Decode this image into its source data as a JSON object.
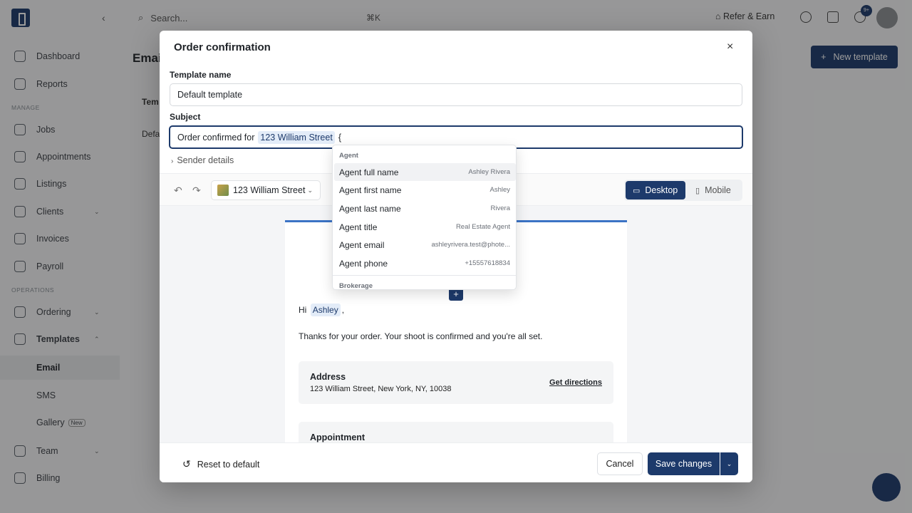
{
  "sidebar": {
    "items": [
      {
        "label": "Dashboard"
      },
      {
        "label": "Reports"
      },
      {
        "label": "Jobs"
      },
      {
        "label": "Appointments"
      },
      {
        "label": "Listings"
      },
      {
        "label": "Clients"
      },
      {
        "label": "Invoices"
      },
      {
        "label": "Payroll"
      },
      {
        "label": "Ordering"
      },
      {
        "label": "Templates"
      },
      {
        "label": "Team"
      },
      {
        "label": "Billing"
      }
    ],
    "sections": [
      "MANAGE",
      "OPERATIONS"
    ],
    "sub_items": [
      {
        "label": "Email"
      },
      {
        "label": "SMS"
      },
      {
        "label": "Gallery"
      }
    ],
    "new_tag": "New"
  },
  "topbar": {
    "search_placeholder": "Search...",
    "search_shortcut": "⌘K",
    "refer_label": "Refer & Earn",
    "notification_count": "9+"
  },
  "page": {
    "title": "Emai",
    "new_template_label": "New template",
    "col_header": "Tem",
    "row_text": "Defa"
  },
  "modal": {
    "title": "Order confirmation",
    "close_glyph": "×",
    "template_name_label": "Template name",
    "template_name_value": "Default template",
    "subject_label": "Subject",
    "subject_prefix": "Order confirmed for",
    "subject_chip": "123 William Street",
    "subject_typed": "{",
    "sender_label": "Sender details",
    "toolbar": {
      "listing": "123 William Street",
      "desktop_label": "Desktop",
      "mobile_label": "Mobile"
    },
    "email": {
      "greet_prefix": "Hi",
      "greet_chip": "Ashley",
      "greet_suffix": ",",
      "body": "Thanks for your order. Your shoot is confirmed and you're all set.",
      "address_title": "Address",
      "address_value": "123 William Street, New York, NY, 10038",
      "directions_label": "Get directions",
      "appointment_title": "Appointment"
    },
    "footer": {
      "reset_label": "Reset to default",
      "cancel_label": "Cancel",
      "save_label": "Save changes"
    }
  },
  "dropdown": {
    "section_agent": "Agent",
    "section_brokerage": "Brokerage",
    "items": [
      {
        "label": "Agent full name",
        "value": "Ashley Rivera"
      },
      {
        "label": "Agent first name",
        "value": "Ashley"
      },
      {
        "label": "Agent last name",
        "value": "Rivera"
      },
      {
        "label": "Agent title",
        "value": "Real Estate Agent"
      },
      {
        "label": "Agent email",
        "value": "ashleyrivera.test@phote..."
      },
      {
        "label": "Agent phone",
        "value": "+15557618834"
      }
    ]
  },
  "colors": {
    "brand": "#1d3a6b",
    "accent_line": "#3b73c5",
    "chip_bg": "#e3ecf8"
  }
}
